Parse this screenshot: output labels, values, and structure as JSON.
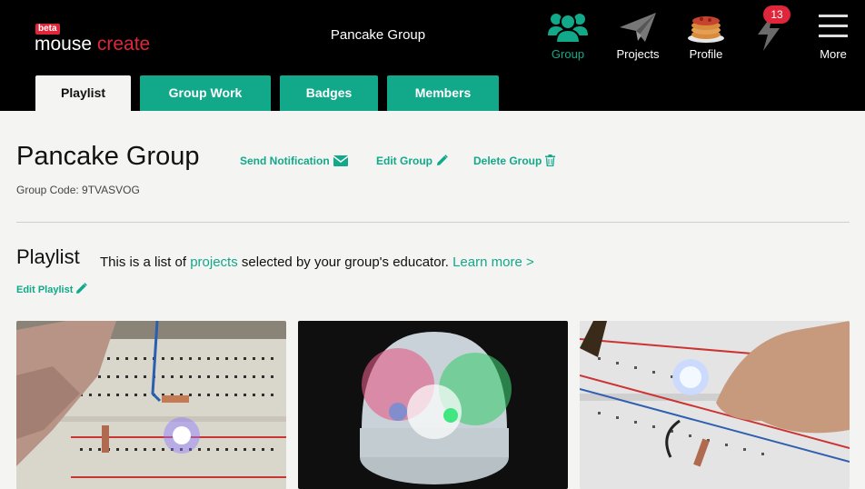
{
  "logo": {
    "beta": "beta",
    "word1": "mouse",
    "word2": "create"
  },
  "header": {
    "title": "Pancake Group"
  },
  "nav": [
    {
      "label": "Group",
      "icon": "group-icon"
    },
    {
      "label": "Projects",
      "icon": "paper-plane-icon"
    },
    {
      "label": "Profile",
      "icon": "pancake-avatar-icon"
    },
    {
      "label": "",
      "icon": "lightning-icon",
      "badge": "13"
    },
    {
      "label": "More",
      "icon": "hamburger-menu-icon"
    }
  ],
  "tabs": [
    {
      "label": "Playlist",
      "active": true
    },
    {
      "label": "Group Work",
      "active": false
    },
    {
      "label": "Badges",
      "active": false
    },
    {
      "label": "Members",
      "active": false
    }
  ],
  "group": {
    "title": "Pancake Group",
    "code": "Group Code: 9TVASVOG",
    "actions": {
      "send": "Send Notification",
      "edit": "Edit Group",
      "delete": "Delete Group"
    }
  },
  "playlist": {
    "title": "Playlist",
    "desc_pre": "This is a list of ",
    "desc_link": "projects",
    "desc_post": " selected by your group's educator. ",
    "learn_more": "Learn more >",
    "edit": "Edit Playlist"
  },
  "colors": {
    "accent": "#12a88a",
    "brand_red": "#e0263a",
    "header_bg": "#000000"
  }
}
